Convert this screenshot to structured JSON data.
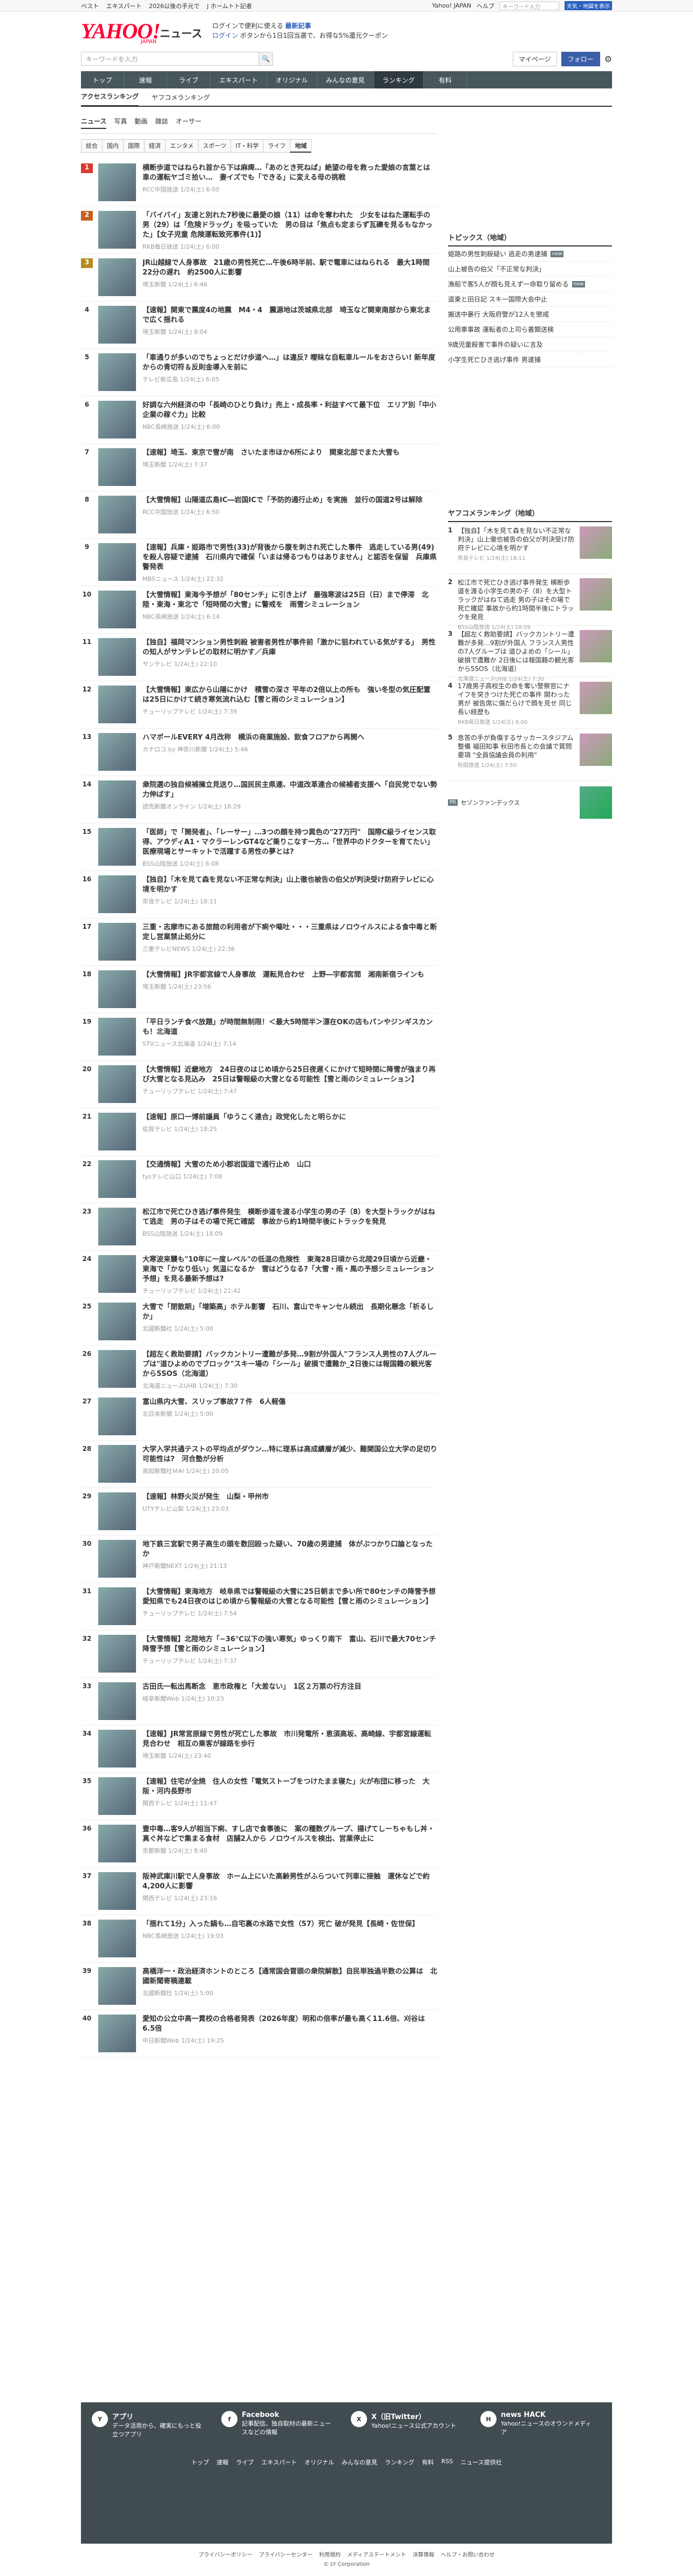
{
  "topbar": {
    "links": [
      "ベスト",
      "エキスパート",
      "2026以後の手元で",
      "J ホームトト記者",
      "Yahoo! JAPAN"
    ],
    "right_links": [
      "Yahoo! JAPAN",
      "ヘルプ"
    ],
    "search_placeholder": "キーワード入力",
    "search_button": "天気・地図を表示"
  },
  "header": {
    "brand": "YAHOO!",
    "japan": "JAPAN",
    "section": "ニュース",
    "promo_line1": "ログインで便利に使える",
    "promo_strong": "最新記事",
    "promo_line2": "ログイン",
    "promo_line3": "ボタンから1日1回当選で、お得な5%還元クーポン"
  },
  "search": {
    "placeholder": "キーワードを入力",
    "mypage": "マイページ",
    "follow": "フォロー"
  },
  "gnav": [
    "トップ",
    "速報",
    "ライブ",
    "エキスパート",
    "オリジナル",
    "みんなの意見",
    "ランキング",
    "有料"
  ],
  "gnav_active": 6,
  "subnav": [
    "アクセスランキング",
    "ヤフコメランキング"
  ],
  "type_tabs": [
    "ニュース",
    "写真",
    "動画",
    "雑誌",
    "オーサー"
  ],
  "cat_tabs": [
    "総合",
    "国内",
    "国際",
    "経済",
    "エンタメ",
    "スポーツ",
    "IT・科学",
    "ライフ",
    "地域"
  ],
  "cat_active": 8,
  "items": [
    {
      "rank": "1",
      "title": "横断歩道ではねられ首から下は麻痺…「あのとき死ねば」絶望の母を救った愛娘の言葉とは　車の運転ヤゴミ拾い…　妻イズでも「できる」に変える母の挑戦",
      "meta": "RCC中国放送 1/24(土) 6:00"
    },
    {
      "rank": "2",
      "title": "「バイバイ」友達と別れた7秒後に最愛の娘（11）は命を奪われた　少女をはねた運転手の男（29）は「危険ドラッグ」を吸っていた　男の目は「焦点も定まらず瓦礫を見るもなかった」【女子児童 危険運転致死事件(1)】",
      "meta": "RKB毎日放送 1/24(土) 6:00"
    },
    {
      "rank": "3",
      "title": "JR山越線で人身事故　21歳の男性死亡…午後6時半前、駅で電車にはねられる　最大1時間22分の遅れ　約2500人に影響",
      "meta": "埼玉新聞 1/24(土) 6:46"
    },
    {
      "rank": "4",
      "title": "【速報】関東で震度4の地震　M4・4　震源地は茨城県北部　埼玉など関東南部から東北まで広く揺れる",
      "meta": "埼玉新聞 1/24(土) 8:04"
    },
    {
      "rank": "5",
      "title": "「車通りが多いのでちょっとだけ歩道へ…」は違反? 曖昧な自転車ルールをおさらい! 新年度からの青切符＆反則金導入を前に",
      "meta": "テレビ新広島 1/24(土) 6:05"
    },
    {
      "rank": "6",
      "title": "好調な六州経済の中「長崎のひとり負け」売上・成長率・利益すべて最下位　エリア別「中小企業の稼ぐ力」比較",
      "meta": "NBC長崎放送 1/24(土) 6:00"
    },
    {
      "rank": "7",
      "title": "【速報】埼玉、東京で雪が南　さいたま市ほか6所により　関東北部でまた大雪も",
      "meta": "埼玉新聞 1/24(土) 7:37"
    },
    {
      "rank": "8",
      "title": "【大雪情報】山陽道広島IC―岩国ICで「予防的通行止め」を実施　並行の国道2号は解除",
      "meta": "RCC中国放送 1/24(土) 6:50"
    },
    {
      "rank": "9",
      "title": "【速報】兵庫・姫路市で男性(33)が背後から腹を刺され死亡した事件　逃走している男(49)を殺人容疑で逮捕　石川県内で確保「いまは帰るつもりはありません」と認否を保留　兵庫県警発表",
      "meta": "MBSニュース 1/24(土) 22:32"
    },
    {
      "rank": "10",
      "title": "【大雪情報】東海今予想が「80センチ」に引き上げ　最強寒波は25日（日）まで停滞　北陸・東海・東北で「短時間の大雪」に警戒を　雨雪シミュレーション",
      "meta": "NBC長崎放送 1/24(土) 6:14"
    },
    {
      "rank": "11",
      "title": "【独自】福岡マンション男性刺殺 被害者男性が事件前「激かに狙われている気がする」　男性の知人がサンテレビの取材に明かす／兵庫",
      "meta": "サンテレビ 1/24(土) 22:10"
    },
    {
      "rank": "12",
      "title": "【大雪情報】東広から山陽にかけ　積雪の深さ 平年の2倍以上の所も　強い冬型の気圧配置は25日にかけて続き寒気流れ込む【雪と雨のシミュレーション】",
      "meta": "チューリップテレビ 1/24(土) 7:39"
    },
    {
      "rank": "13",
      "title": "ハマボールEVERY 4月改称　横浜の商業施設、飲食フロアから再開へ",
      "meta": "カナロコ by 神奈川新聞 1/24(土) 5:46"
    },
    {
      "rank": "14",
      "title": "衆院選の独自候補擁立見送り…国民民主県連、中道改革連合の候補者支援へ「自民党でない勢力伸ばす」",
      "meta": "読売新聞オンライン 1/24(土) 16:29"
    },
    {
      "rank": "15",
      "title": "「医師」で「開発者」、「レーサー」…3つの顔を持つ異色の\"27万円\"　国際C級ライセンス取得、アウディA1・マクラーレンGT4など乗りこなす一方…「世界中のドクターを育てたい」医療現場とサーキットで活躍する男性の夢とは?",
      "meta": "BSS山陰放送 1/24(土) 6:08"
    },
    {
      "rank": "16",
      "title": "【独自】「木を見て森を見ない不正常な判決」山上徹也被告の伯父が判決受け防府テレビに心境を明かす",
      "meta": "奈良テレビ 1/24(土) 18:11"
    },
    {
      "rank": "17",
      "title": "三重・志摩市にある旅館の利用者が下痢や嘔吐・・・三重県はノロウイルスによる食中毒と断定し営業禁止処分に",
      "meta": "三重テレビNEWS 1/24(土) 22:36"
    },
    {
      "rank": "18",
      "title": "【大雪情報】JR宇都宮線で人身事故　運転見合わせ　上野―宇都宮間　湘南新宿ラインも",
      "meta": "埼玉新聞 1/24(土) 23:56"
    },
    {
      "rank": "19",
      "title": "「平日ランチ食べ放題」が時間無制限！＜最大5時間半＞漂在OKの店もパンやジンギスカンも！北海道",
      "meta": "STVニュース北海道 1/24(土) 7:14"
    },
    {
      "rank": "20",
      "title": "【大雪情報】近畿地方　24日夜のはじめ頃から25日夜遅くにかけて短時間に降雪が強まり再び大雪となる見込み　25日は警報級の大雪となる可能性【雪と雨のシミュレーション】",
      "meta": "チューリップテレビ 1/24(土) 7:47"
    },
    {
      "rank": "21",
      "title": "【速報】原口一博前議員「ゆうこく連合」政党化したと明らかに",
      "meta": "佐賀テレビ 1/24(土) 18:25"
    },
    {
      "rank": "22",
      "title": "【交通情報】大雪のため小郡岩国道で通行止め　山口",
      "meta": "tysテレビ山口 1/24(土) 7:08"
    },
    {
      "rank": "23",
      "title": "松江市で死亡ひき逃げ事件発生　横断歩道を渡る小学生の男の子（8）を大型トラックがはねて逃走　男の子はその場で死亡確認　事故から約1時間半後にトラックを発見",
      "meta": "BSS山陰放送 1/24(土) 18:09"
    },
    {
      "rank": "24",
      "title": "大寒波来襲も\"10年に一度レベル\"の低温の危険性　東海28日頃から北陸29日頃から近畿・東海で「かなり低い」気温になるか　雪はどうなる?「大雪・雨・風の予想シミュレーション予想」を見る最新予想は?",
      "meta": "チューリップテレビ 1/24(土) 21:42"
    },
    {
      "rank": "25",
      "title": "大雪で「閉散期」「増築高」ホテル影響　石川、富山でキャンセル続出　長期化懸念「祈るしか」",
      "meta": "北國新聞社 1/24(土) 5:00"
    },
    {
      "rank": "26",
      "title": "【超左く救助要請】バックカントリー遭難が多発…9割が外国人\"フランス人男性の7人グループは\"道ひよめのでブロック\"スキー場の「シール」破損で遭難か_2日後には報国籍の観光客から5SOS（北海道）",
      "meta": "北海道ニュースUHB 1/24(土) 7:30"
    },
    {
      "rank": "27",
      "title": "富山県内大雪、スリップ事故7７件　6人軽傷",
      "meta": "北日本新聞 1/24(土) 5:00"
    },
    {
      "rank": "28",
      "title": "大学入学共通テストの平均点がダウン…特に理系は高成績層が減少、難関国公立大学の足切り可能性は?　河合塾が分析",
      "meta": "高知新聞社ＭAI 1/24(土) 20:05"
    },
    {
      "rank": "29",
      "title": "【速報】林野火災が発生　山梨・甲州市",
      "meta": "UTYテレビ山梨 1/24(土) 23:03"
    },
    {
      "rank": "30",
      "title": "地下鉄三宮駅で男子高生の頭を数回殴った疑い、70歳の男逮捕　体がぶつかり口論となったか",
      "meta": "神戸新聞NEXT 1/24(土) 21:13"
    },
    {
      "rank": "31",
      "title": "【大雪情報】東海地方　岐阜県では警報級の大雪に25日朝まで多い所で80センチの降雪予想　愛知県でも24日夜のはじめ頃から警報級の大雪となる可能性【雪と雨のシミュレーション】",
      "meta": "チューリップテレビ 1/24(土) 7:54"
    },
    {
      "rank": "32",
      "title": "【大雪情報】北陸地方「−36℃以下の強い寒気」ゆっくり南下　富山、石川で最大70センチ降雪予想【雪と雨のシミュレーション】",
      "meta": "チューリップテレビ 1/24(土) 7:37"
    },
    {
      "rank": "33",
      "title": "古田氏一転出馬断念　恵市政権と「大差ない」　1区２万票の行方注目",
      "meta": "岐阜新聞Web 1/24(土) 10:23"
    },
    {
      "rank": "34",
      "title": "【速報】JR常宮原線で男性が死亡した事故　市川発電所・恵須高坂、高崎線、宇都宮線運転見合わせ　相互の乗客が線路を歩行",
      "meta": "埼玉新聞 1/24(土) 23:40"
    },
    {
      "rank": "35",
      "title": "【速報】住宅が全焼　住人の女性「電気ストーブをつけたまま寝た」火が布団に移った　大阪・河内長野市",
      "meta": "関西テレビ 1/24(土) 11:47"
    },
    {
      "rank": "36",
      "title": "壹中毒…客9人が相当下痢、すし店で食事後に　案の種数グループ、揚げてしーちゃもし丼・真ぐ丼などで集まる食材　店舗2人から ノロウイルスを検出、営業停止に",
      "meta": "京都新聞 1/24(土) 8:40"
    },
    {
      "rank": "37",
      "title": "阪神武庫川駅で人身事故　ホーム上にいた高齢男性がふらついて列車に接触　運休などで約4,200人に影響",
      "meta": "関西テレビ 1/24(土) 23:16"
    },
    {
      "rank": "38",
      "title": "「揺れて1分」入った鍋も…自宅裏の水路で女性（57）死亡 破が発見【長崎・佐世保】",
      "meta": "NBC長崎放送 1/24(土) 19:03"
    },
    {
      "rank": "39",
      "title": "高橋洋一・政治経済ホントのところ【通常国会冒頭の衆院解散】自民単独過半数の公算は　北國新聞寄稿連載",
      "meta": "北國新聞社 1/24(土) 5:00"
    },
    {
      "rank": "40",
      "title": "愛知の公立中高一貫校の合格者発表（2026年度）明和の倍率が最も高く11.6倍、刈谷は6.5倍",
      "meta": "中日新聞Web 1/24(土) 19:25"
    }
  ],
  "sidebar": {
    "topics_title": "トピックス（地域）",
    "topics": [
      {
        "label": "姫路の男性刺殺疑い 逃走の男逮捕",
        "badge": "new"
      },
      {
        "label": "山上被告の伯父「不正常な判決」",
        "badge": ""
      },
      {
        "label": "漁船で客5人が顔も見えず一命取り留める",
        "badge": "new"
      },
      {
        "label": "道東と田日記 スキー国際大会中止",
        "badge": ""
      },
      {
        "label": "搬送中暴行 大阪府警が12人を懲戒",
        "badge": ""
      },
      {
        "label": "公用車事故 運転者の上司ら書類送検",
        "badge": ""
      },
      {
        "label": "9歳児童殺害で事件の疑いに言及",
        "badge": ""
      },
      {
        "label": "小学生死亡ひき逃げ事件 男逮捕",
        "badge": ""
      }
    ],
    "yahoo_title": "ヤフコメランキング（地域）",
    "yahoo_items": [
      {
        "rank": "1",
        "title": "【独自】「木を見て森を見ない不正常な判決」山上徹也被告の伯父が判決受け防府テレビに心境を明かす",
        "meta": "奈良テレビ 1/24(土) 18:11"
      },
      {
        "rank": "2",
        "title": "松江市で死亡ひき逃げ事件発生 横断歩道を渡る小学生の男の子（8）を大型トラックがはねて逃走 男の子はその場で死亡確認 事故から約1時間半後にトラックを発見",
        "meta": "BSS山陰放送 1/24(土) 18:09"
      },
      {
        "rank": "3",
        "title": "【超左く救助要請】バックカントリー遭難が多発…9割が外国人 フランス人男性の7人グループは 道ひよめの「シール」破損で遭難か 2日後には報国籍の観光客から5SOS（北海道）",
        "meta": "北海道ニュースUHB 1/24(土) 7:30"
      },
      {
        "rank": "4",
        "title": "17歳男子高校生の命を奪い警察官にナイフを突きつけた死亡の事件 関わった男が 被告席に傷だらけで顔を見せ 同じ長い経歴も",
        "meta": "RKB毎日放送 1/24(土) 6:00"
      },
      {
        "rank": "5",
        "title": "息苦の手が負傷するサッカースタジアム整備 福田知事 秋田市長との会議で質問要項 \"全員協議会員の利用\"",
        "meta": "秋田放送 1/24(土) 7:50"
      }
    ],
    "pr_label": "PR",
    "pr_text": "セゾンファンデックス"
  },
  "footer": {
    "apps": [
      {
        "name": "アプリ",
        "desc": "データ活用から、確実にもっと役立つアプリ",
        "icon": "Y"
      },
      {
        "name": "Facebook",
        "desc": "記事配信、独自取材の最新ニュースなどの情報",
        "icon": "f"
      },
      {
        "name": "X（旧Twitter）",
        "desc": "Yahoo!ニュース公式アカウント",
        "icon": "X"
      },
      {
        "name": "news HACK",
        "desc": "Yahoo!ニュースのオウンドメディア",
        "icon": "H"
      }
    ],
    "links": [
      "トップ",
      "速報",
      "ライブ",
      "エキスパート",
      "オリジナル",
      "みんなの意見",
      "ランキング",
      "有料",
      "RSS",
      "ニュース提供社"
    ],
    "bottom_links": [
      "プライバシーポリシー",
      "プライバシーセンター",
      "利用規約",
      "メディアステートメント",
      "決算情報",
      "ヘルプ・お問い合わせ"
    ],
    "copyright": "© LY Corporation"
  }
}
